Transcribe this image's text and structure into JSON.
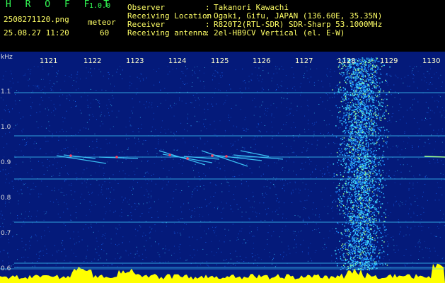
{
  "header": {
    "app_name": "H R O F F T",
    "app_version": "1.0.0",
    "filename": "2508271120.png",
    "datetime": "25.08.27 11:20",
    "mode_label": "meteor",
    "count": "60",
    "info": [
      {
        "label": "Observer",
        "value": "Takanori Kawachi"
      },
      {
        "label": "Receiving Location",
        "value": "Ogaki, Gifu, JAPAN (136.60E, 35.35N)"
      },
      {
        "label": "Receiver",
        "value": "R820T2(RTL-SDR) SDR-Sharp 53.1000MHz"
      },
      {
        "label": "Receiving antenna",
        "value": "2el-HB9CV Vertical (el. E-W)"
      }
    ]
  },
  "spectrogram": {
    "y_unit": "kHz",
    "y_ticks": [
      "1.1",
      "1.0",
      "0.9",
      "0.8",
      "0.7",
      "0.6"
    ],
    "x_ticks": [
      "1121",
      "1122",
      "1123",
      "1124",
      "1125",
      "1126",
      "1127",
      "1128",
      "1129",
      "1130"
    ],
    "colors": {
      "background": "#041a7a",
      "noise": "#1a6cff",
      "line": "#40d0ff",
      "meteor": "#ff4060",
      "trace": "#ffff00"
    }
  }
}
